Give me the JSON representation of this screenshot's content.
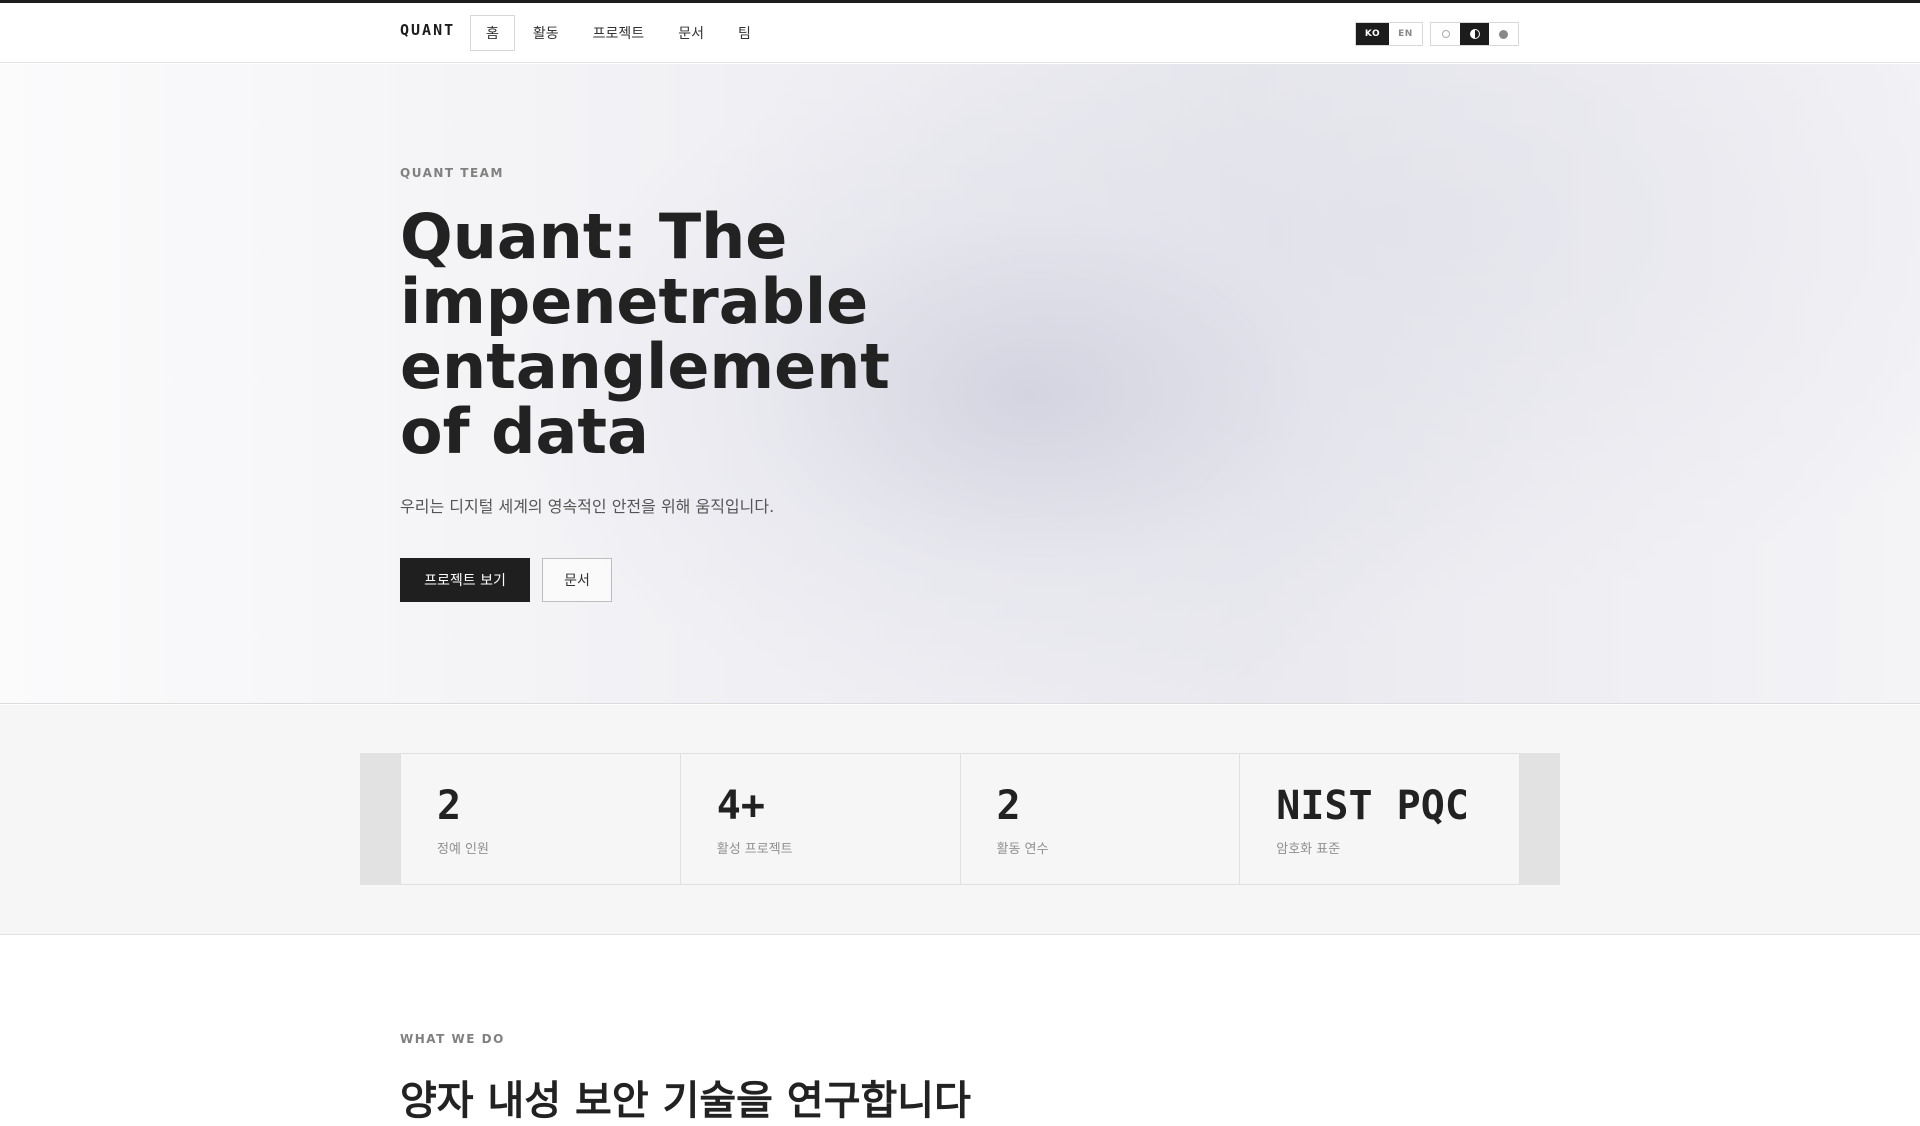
{
  "nav": {
    "brand": "QUANT",
    "links": [
      "홈",
      "활동",
      "프로젝트",
      "문서",
      "팀"
    ],
    "lang": [
      "KO",
      "EN"
    ],
    "theme_icons": [
      "light-mode-icon",
      "auto-mode-icon",
      "dark-mode-icon"
    ]
  },
  "hero": {
    "eyebrow": "QUANT TEAM",
    "title": "Quant: The impenetrable entanglement of data",
    "subtitle": "우리는 디지털 세계의 영속적인 안전을 위해 움직입니다.",
    "primary_button": "프로젝트 보기",
    "secondary_button": "문서"
  },
  "stats": [
    {
      "value": "2",
      "label": "정예 인원"
    },
    {
      "value": "4+",
      "label": "활성 프로젝트"
    },
    {
      "value": "2",
      "label": "활동 연수"
    },
    {
      "value": "NIST PQC",
      "label": "암호화 표준"
    }
  ],
  "section": {
    "eyebrow": "WHAT WE DO",
    "title": "양자 내성 보안 기술을 연구합니다"
  }
}
